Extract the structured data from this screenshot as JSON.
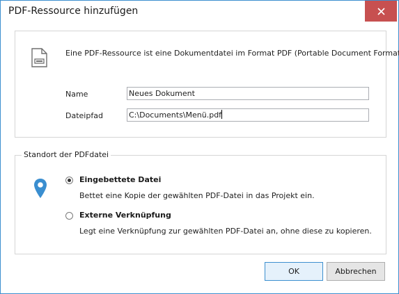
{
  "window": {
    "title": "PDF-Ressource hinzufügen"
  },
  "info": {
    "description": "Eine PDF-Ressource ist eine Dokumentdatei im Format PDF (Portable Document Format)."
  },
  "form": {
    "name_label": "Name",
    "name_value": "Neues Dokument",
    "path_label": "Dateipfad",
    "path_value": "C:\\Documents\\Menü.pdf"
  },
  "location": {
    "legend": "Standort der PDFdatei",
    "options": [
      {
        "title": "Eingebettete Datei",
        "description": "Bettet eine Kopie der gewählten PDF-Datei in das Projekt ein.",
        "selected": true
      },
      {
        "title": "Externe Verknüpfung",
        "description": "Legt eine Verknüpfung zur gewählten PDF-Datei an, ohne diese zu kopieren.",
        "selected": false
      }
    ]
  },
  "buttons": {
    "ok": "OK",
    "cancel": "Abbrechen"
  },
  "colors": {
    "accent": "#3c8fcf",
    "close": "#c75050",
    "pin": "#3a8ed0"
  },
  "icons": [
    "close-icon",
    "pdf-document-icon",
    "location-pin-icon"
  ]
}
